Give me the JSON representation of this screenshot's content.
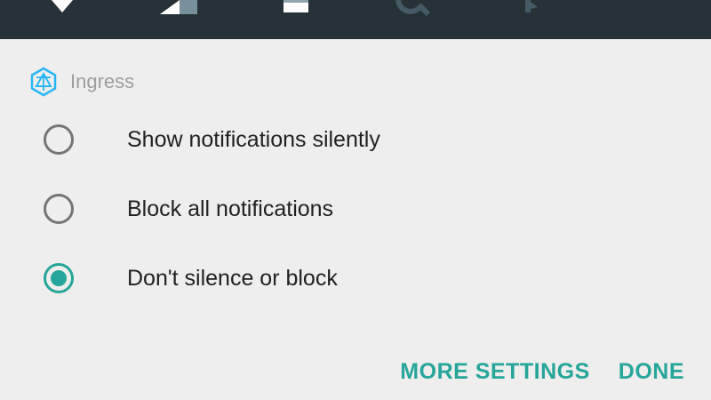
{
  "status_bar": {
    "background": "#263238",
    "icons": [
      "wifi-icon",
      "signal-icon",
      "battery-icon",
      "search-icon",
      "notification-icon"
    ]
  },
  "app": {
    "name": "Ingress",
    "icon": "ingress-logo-icon",
    "icon_color": "#29b6f6"
  },
  "options": [
    {
      "label": "Show notifications silently",
      "selected": false
    },
    {
      "label": "Block all notifications",
      "selected": false
    },
    {
      "label": "Don't silence or block",
      "selected": true
    }
  ],
  "actions": {
    "more_settings": "MORE SETTINGS",
    "done": "DONE"
  },
  "colors": {
    "accent": "#26a69a",
    "background": "#eeeeee",
    "text": "#212121",
    "secondary_text": "#9e9e9e"
  }
}
